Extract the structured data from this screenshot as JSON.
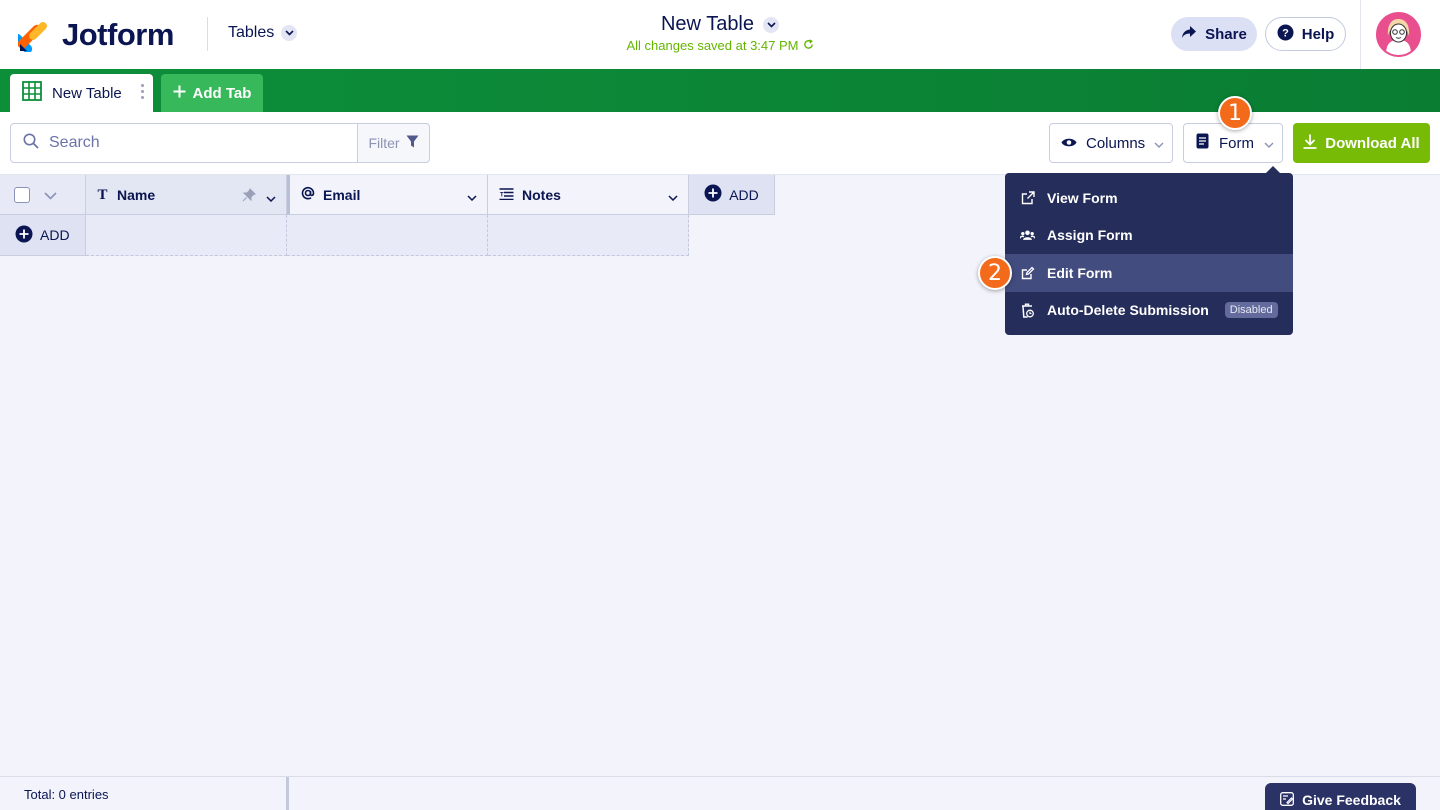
{
  "brand": {
    "name": "Jotform"
  },
  "header": {
    "section_menu": "Tables",
    "title": "New Table",
    "saved_status": "All changes saved at 3:47 PM",
    "share_label": "Share",
    "help_label": "Help"
  },
  "tabs": {
    "items": [
      {
        "label": "New Table"
      }
    ],
    "add_label": "Add Tab"
  },
  "toolbar": {
    "search_placeholder": "Search",
    "filter_label": "Filter",
    "columns_label": "Columns",
    "form_label": "Form",
    "download_label": "Download All"
  },
  "grid": {
    "columns": [
      {
        "label": "Name",
        "icon": "text-icon"
      },
      {
        "label": "Email",
        "icon": "at-icon"
      },
      {
        "label": "Notes",
        "icon": "notes-icon"
      }
    ],
    "add_column_label": "ADD",
    "add_row_label": "ADD"
  },
  "form_menu": {
    "items": [
      {
        "label": "View Form",
        "icon": "external-link-icon"
      },
      {
        "label": "Assign Form",
        "icon": "users-icon"
      },
      {
        "label": "Edit Form",
        "icon": "edit-icon",
        "active": true
      },
      {
        "label": "Auto-Delete Submission",
        "icon": "auto-delete-icon",
        "badge": "Disabled"
      }
    ]
  },
  "steps": [
    "1",
    "2"
  ],
  "footer": {
    "total_label": "Total: 0 entries",
    "feedback_label": "Give Feedback"
  },
  "colors": {
    "tabbar": "#0a7d33",
    "download": "#78bb07",
    "step_marker": "#f46a1b",
    "menu_bg": "#252d5b"
  }
}
